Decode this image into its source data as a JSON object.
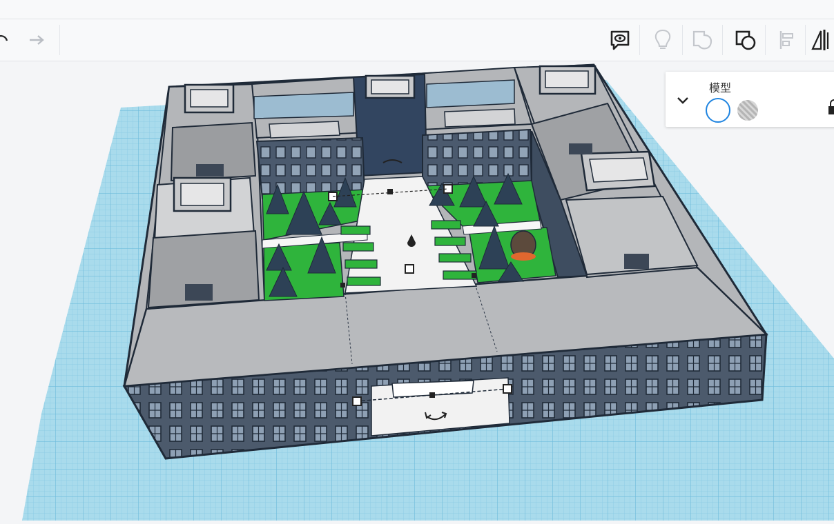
{
  "app": {
    "toolbar": {
      "undo_icon": "undo-icon",
      "redo_icon": "redo-icon",
      "tools": [
        {
          "name": "notes-icon",
          "state": "active"
        },
        {
          "name": "lightbulb-icon",
          "state": "disabled"
        },
        {
          "name": "group-shape-icon",
          "state": "disabled"
        },
        {
          "name": "ungroup-shape-icon",
          "state": "active"
        },
        {
          "name": "align-icon",
          "state": "disabled"
        },
        {
          "name": "mirror-icon",
          "state": "active"
        }
      ]
    },
    "inspector": {
      "title": "模型",
      "solid_label": "solid",
      "hole_label": "hole"
    },
    "colors": {
      "workplane": "#a9dbec",
      "accent": "#1f84e0",
      "building_roof": "#b4b6b9",
      "wall": "#3c4a5e",
      "grass": "#2fb43c",
      "tree": "#2d4156"
    }
  }
}
